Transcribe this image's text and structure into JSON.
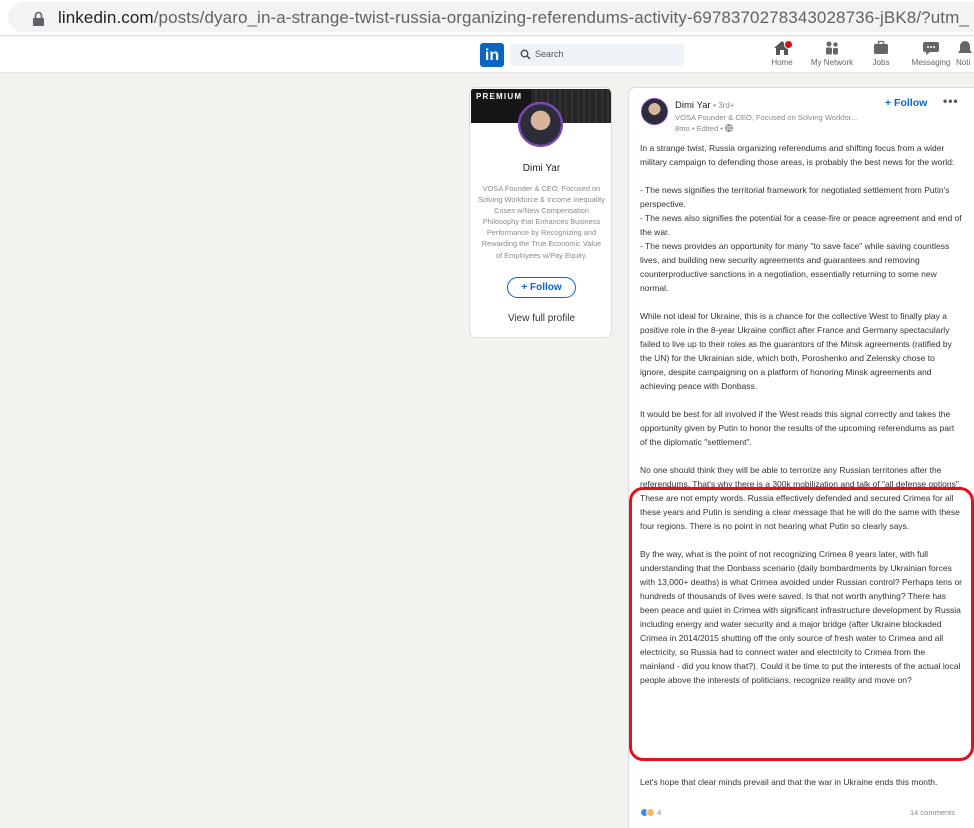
{
  "browser": {
    "url_host": "linkedin.com",
    "url_path": "/posts/dyaro_in-a-strange-twist-russia-organizing-referendums-activity-6978370278343028736-jBK8/?utm_"
  },
  "header": {
    "logo": "in",
    "search_placeholder": "Search",
    "nav": [
      {
        "label": "Home",
        "icon": "home-icon"
      },
      {
        "label": "My Network",
        "icon": "network-icon"
      },
      {
        "label": "Jobs",
        "icon": "jobs-icon"
      },
      {
        "label": "Messaging",
        "icon": "messaging-icon"
      },
      {
        "label": "Noti",
        "icon": "notifications-icon"
      }
    ],
    "accent_color": "#0a66c2",
    "badge_color": "#cc1016"
  },
  "profile_card": {
    "banner_label": "PREMIUM",
    "name": "Dimi Yar",
    "headline": "VOSA Founder & CEO, Focused on Solving Workforce & Income Inequality Crises w/New Compensation Philosophy that Enhances Business Performance by Recognizing and Rewarding the True Economic Value of Employees w/Pay Equity.",
    "follow_label": "+ Follow",
    "view_profile_label": "View full profile"
  },
  "post": {
    "author_name": "Dimi Yar",
    "author_degree": "• 3rd+",
    "author_headline": "VOSA Founder & CEO, Focused on Solving Workfor...",
    "meta": "8mo • Edited •",
    "follow_label": "+ Follow",
    "more_label": "•••",
    "paragraphs": {
      "p1": "In a strange twist, Russia organizing referendums and shifting focus from a wider military campaign to defending those areas, is probably the best news for the world:",
      "p2a": "- The news signifies the territorial framework for negotiated settlement from Putin's perspective.",
      "p2b": "- The news also signifies the potential for a cease-fire or peace agreement and end of the war.",
      "p2c": "- The news provides an opportunity for many \"to save face\" while saving countless lives, and building new security agreements and guarantees and removing counterproductive sanctions in a negotiation, essentially returning to some new normal.",
      "p3": "While not ideal for Ukraine, this is a chance for the collective West to finally play a positive role in the 8-year Ukraine conflict after France and Germany spectacularly failed to live up to their roles as the guarantors of the Minsk agreements (ratified by the UN) for the Ukrainian side, which both, Poroshenko and Zelensky chose to ignore, despite campaigning on a platform of honoring Minsk agreements and achieving peace with Donbass.",
      "p4": "It would be best for all involved if the West reads this signal correctly and takes the opportunity given by Putin to honor the results of the upcoming referendums as part of the diplomatic \"settlement\".",
      "p5": "No one should think they will be able to terrorize any Russian territories after the referendums. That's why there is a 300k mobilization and talk of \"all defense options\". These are not empty words. Russia effectively defended and secured Crimea for all these years and Putin is sending a clear message that he will do the same with these four regions. There is no point in not hearing what Putin so clearly says.",
      "p6": "By the way, what is the point of not recognizing Crimea 8 years later, with full understanding that the Donbass scenario (daily bombardments by Ukrainian forces with 13,000+ deaths) is what Crimea avoided under Russian control? Perhaps tens or hundreds of thousands of lives were saved. Is that not worth anything? There has been peace and quiet in Crimea with significant infrastructure development by Russia including energy and water security and a major bridge (after Ukraine blockaded Crimea in 2014/2015 shutting off the only source of fresh water to Crimea and all electricity, so Russia had to connect water and electricity to Crimea from the mainland - did you know that?). Could it be time to put the interests of the actual local people above the interests of politicians, recognize reality and move on?",
      "p7": "Let's hope that clear minds prevail and that the war in Ukraine ends this month."
    },
    "reaction_count": "4",
    "comments_label": "14 comments",
    "highlight_color": "#e3111a"
  }
}
